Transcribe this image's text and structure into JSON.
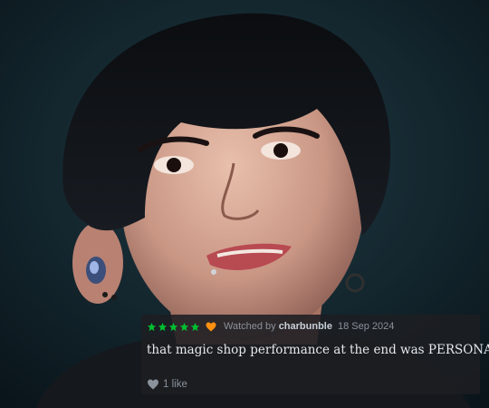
{
  "review": {
    "rating_stars": 5,
    "liked": true,
    "watched_by_label": "Watched by",
    "username": "charbunble",
    "date": "18 Sep 2024",
    "text": "that magic shop performance at the end was PERSONAL",
    "likes_label": "1 like"
  },
  "colors": {
    "star": "#00c030",
    "liked_heart": "#ff9010",
    "like_icon": "#8a929b"
  },
  "icons": [
    "star-icon",
    "heart-liked-icon",
    "heart-like-icon"
  ]
}
